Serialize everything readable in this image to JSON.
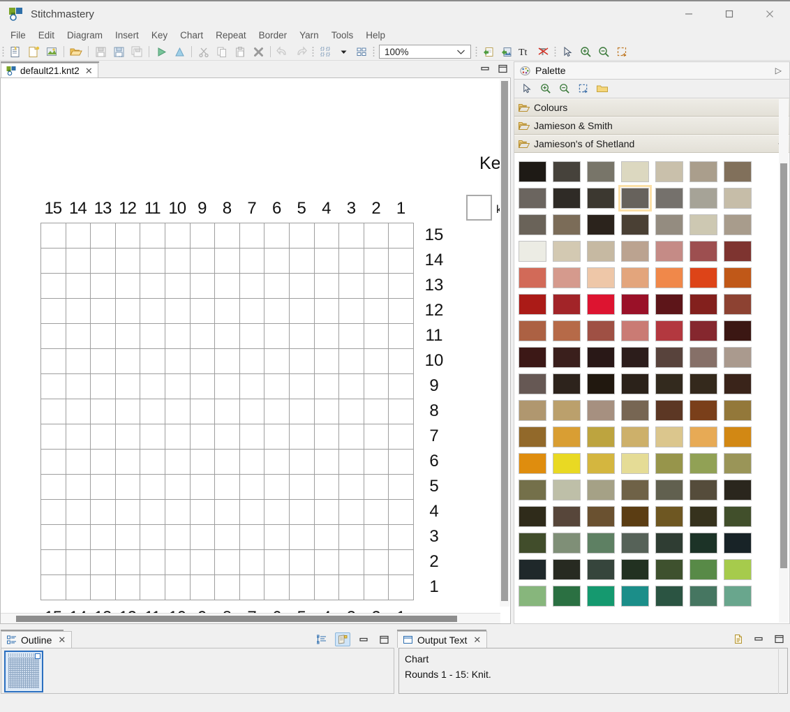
{
  "window": {
    "title": "Stitchmastery",
    "logo_icon": "app-logo-icon",
    "minimize_label": "–",
    "maximize_label": "□",
    "close_label": "✕"
  },
  "menubar": {
    "items": [
      {
        "label": "File"
      },
      {
        "label": "Edit"
      },
      {
        "label": "Diagram"
      },
      {
        "label": "Insert"
      },
      {
        "label": "Key"
      },
      {
        "label": "Chart"
      },
      {
        "label": "Repeat"
      },
      {
        "label": "Border"
      },
      {
        "label": "Yarn"
      },
      {
        "label": "Tools"
      },
      {
        "label": "Help"
      }
    ]
  },
  "toolbar": {
    "zoom_value": "100%",
    "zoom_chevron": "⌄",
    "buttons": [
      {
        "name": "new-chart-icon"
      },
      {
        "name": "new-diagram-icon"
      },
      {
        "name": "new-colourwork-icon"
      },
      {
        "name": "open-folder-icon"
      },
      {
        "name": "save-icon"
      },
      {
        "name": "save-as-icon"
      },
      {
        "name": "save-all-icon"
      },
      {
        "name": "play-right-icon"
      },
      {
        "name": "play-up-icon"
      },
      {
        "name": "cut-scissors-icon"
      },
      {
        "name": "copy-icon"
      },
      {
        "name": "paste-icon"
      },
      {
        "name": "delete-x-icon"
      },
      {
        "name": "undo-icon"
      },
      {
        "name": "redo-icon"
      },
      {
        "name": "align-nodes-icon"
      },
      {
        "name": "align-dropdown-icon"
      },
      {
        "name": "distribute-icon"
      },
      {
        "name": "import-icon"
      },
      {
        "name": "export-image-icon"
      },
      {
        "name": "text-tool-icon"
      },
      {
        "name": "clear-formatting-icon"
      },
      {
        "name": "select-arrow-icon"
      },
      {
        "name": "zoom-in-icon"
      },
      {
        "name": "zoom-out-icon"
      },
      {
        "name": "marquee-zoom-icon"
      }
    ]
  },
  "editor": {
    "tab": {
      "label": "default21.knt2",
      "icon": "document-icon",
      "close": "✕"
    },
    "minimize": "➖",
    "maximize": "❐",
    "key_heading": "Ke",
    "key_cut_label": "k",
    "chart": {
      "columns": [
        "15",
        "14",
        "13",
        "12",
        "11",
        "10",
        "9",
        "8",
        "7",
        "6",
        "5",
        "4",
        "3",
        "2",
        "1"
      ],
      "rows": [
        "15",
        "14",
        "13",
        "12",
        "11",
        "10",
        "9",
        "8",
        "7",
        "6",
        "5",
        "4",
        "3",
        "2",
        "1"
      ],
      "cell_fill": "#ffffff",
      "grid_line": "#9e9e9e"
    }
  },
  "palette": {
    "title": "Palette",
    "title_icon": "palette-icon",
    "expand_arrow": "▷",
    "toolbar": [
      {
        "name": "select-arrow-icon"
      },
      {
        "name": "zoom-in-icon"
      },
      {
        "name": "zoom-out-icon"
      },
      {
        "name": "marquee-zoom-icon"
      },
      {
        "name": "new-folder-icon"
      }
    ],
    "groups": [
      {
        "name": "Colours",
        "collapse": "",
        "expanded": false
      },
      {
        "name": "Jamieson & Smith",
        "collapse": "",
        "expanded": false
      },
      {
        "name": "Jamieson's of Shetland",
        "collapse": "«",
        "expanded": true
      }
    ],
    "selected_index": 10,
    "swatches": [
      "#1e1a15",
      "#46423b",
      "#787569",
      "#dcd8c0",
      "#c9c0ab",
      "#aa9e8c",
      "#81705b",
      "#564староста",
      "#2f2b26",
      "#3c3830",
      "#67625c",
      "#75716c",
      "#a6a397",
      "#c6bda8",
      "#6a6359",
      "#7b6c58",
      "#2b231c",
      "#4a4034",
      "#948c80",
      "#cdc8b2",
      "#a89c8c",
      "#ecece4",
      "#d3c9b2",
      "#c6b9a2",
      "#bba390",
      "#c58b86",
      "#9d4f50",
      "#7e3430",
      "#d26a58",
      "#d59a8d",
      "#eec7a8",
      "#e3a57c",
      "#f0884a",
      "#dd4418",
      "#c05818",
      "#ab1b17",
      "#a22428",
      "#dd1430",
      "#9a1128",
      "#5d1519",
      "#83201d",
      "#8d4232",
      "#ac6143",
      "#b66a48",
      "#9f5044",
      "#ca7b74",
      "#b3383f",
      "#85272e",
      "#3b1713",
      "#3c1816",
      "#3a1f1c",
      "#291817",
      "#2c1d1b",
      "#58433c",
      "#867068",
      "#aa9a8e",
      "#665854",
      "#2d231c",
      "#21180f",
      "#2b221a",
      "#332a1e",
      "#34291c",
      "#3a241a",
      "#b0976f",
      "#bba06c",
      "#a69080",
      "#776653",
      "#5c3724",
      "#7a3f1a",
      "#93783a",
      "#92692a",
      "#d99e33",
      "#bda43f",
      "#cdb06a",
      "#dbc68d",
      "#e7aa55",
      "#d28814",
      "#df8d0e",
      "#e9d923",
      "#d4b63f",
      "#e5dc96",
      "#97954b",
      "#91a155",
      "#9a9558",
      "#74704a",
      "#bebfa8",
      "#a5a186",
      "#6f6247",
      "#61604f",
      "#554c3b",
      "#2a261d",
      "#2f2b1a",
      "#57463a",
      "#6a5130",
      "#5b3d13",
      "#6e5722",
      "#36321d",
      "#414f2b",
      "#414d2b",
      "#7f8f77",
      "#5e8063",
      "#566258",
      "#2f3d33",
      "#1c3327",
      "#182327",
      "#1f282a",
      "#272a21",
      "#36453c",
      "#223121",
      "#3e512e",
      "#588a47",
      "#a6cb4c",
      "#87b67c",
      "#2b7042",
      "#15996f",
      "#1b8e89",
      "#2b5442",
      "#467661",
      "#69a68d"
    ],
    "swatch_border": "#c2c2c2",
    "selection_highlight": "#fbdfa6"
  },
  "outline": {
    "tab_label": "Outline",
    "tab_icon": "outline-icon",
    "close": "✕",
    "actions": [
      {
        "name": "collapse-all-icon"
      },
      {
        "name": "show-thumbnail-icon"
      },
      {
        "name": "minimize-icon"
      },
      {
        "name": "maximize-icon"
      }
    ]
  },
  "output": {
    "tab_label": "Output Text",
    "tab_icon": "output-icon",
    "close": "✕",
    "actions": [
      {
        "name": "copy-text-icon"
      },
      {
        "name": "minimize-icon"
      },
      {
        "name": "maximize-icon"
      }
    ],
    "lines": [
      "Chart",
      "Rounds 1 - 15: Knit."
    ]
  }
}
